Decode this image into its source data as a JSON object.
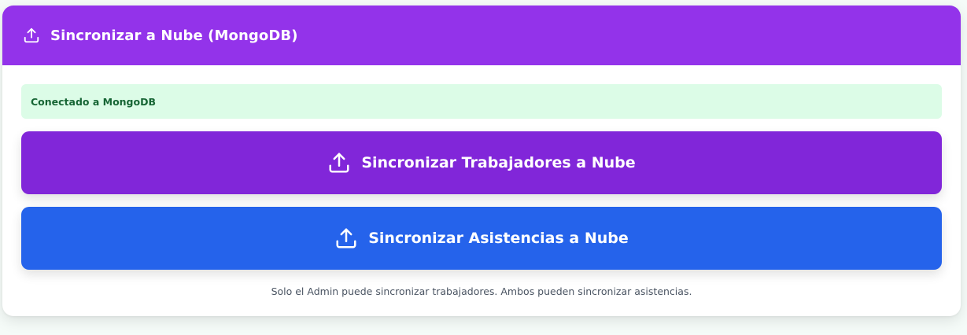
{
  "header": {
    "title": "Sincronizar a Nube (MongoDB)",
    "icon": "upload-icon",
    "background_color": "#9333ea"
  },
  "status": {
    "text": "Conectado a MongoDB",
    "background_color": "#dcfce7",
    "text_color": "#166534"
  },
  "buttons": {
    "sync_workers": {
      "label": "Sincronizar Trabajadores a Nube",
      "icon": "upload-icon",
      "color": "#8126d9"
    },
    "sync_attendance": {
      "label": "Sincronizar Asistencias a Nube",
      "icon": "upload-icon",
      "color": "#2563eb"
    }
  },
  "footnote": "Solo el Admin puede sincronizar trabajadores. Ambos pueden sincronizar asistencias."
}
